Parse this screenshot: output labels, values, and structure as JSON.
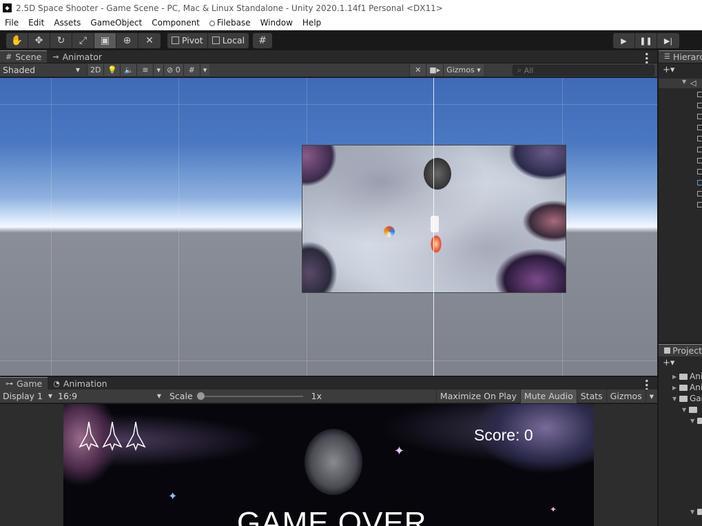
{
  "window": {
    "title": "2.5D Space Shooter - Game Scene - PC, Mac & Linux Standalone - Unity 2020.1.14f1 Personal <DX11>"
  },
  "menu": [
    "File",
    "Edit",
    "Assets",
    "GameObject",
    "Component",
    "Filebase",
    "Window",
    "Help"
  ],
  "toolbar": {
    "tools": [
      "hand-tool-icon",
      "move-tool-icon",
      "rotate-tool-icon",
      "scale-tool-icon",
      "rect-tool-icon",
      "transform-tool-icon",
      "custom-tool-icon"
    ],
    "pivot_label": "Pivot",
    "local_label": "Local"
  },
  "scene_panel": {
    "tabs": [
      "Scene",
      "Animator"
    ],
    "shading_mode": "Shaded",
    "mode_2d": "2D",
    "hidden_count": "0",
    "gizmos_label": "Gizmos",
    "search_placeholder": "All"
  },
  "game_panel": {
    "tabs": [
      "Game",
      "Animation"
    ],
    "display": "Display 1",
    "aspect": "16:9",
    "scale_label": "Scale",
    "scale_value": "1x",
    "maximize_label": "Maximize On Play",
    "mute_label": "Mute Audio",
    "stats_label": "Stats",
    "gizmos_label": "Gizmos",
    "score_text": "Score: 0",
    "game_over_text": "GAME OVER",
    "lives": 3
  },
  "hierarchy": {
    "tab": "Hierarchy"
  },
  "project": {
    "tab": "Project",
    "items": [
      "Animations",
      "Animations",
      "Game"
    ]
  },
  "colors": {
    "accent": "#4a78c1",
    "panel_bg": "#282828",
    "toolbar_bg": "#3c3c3c"
  }
}
